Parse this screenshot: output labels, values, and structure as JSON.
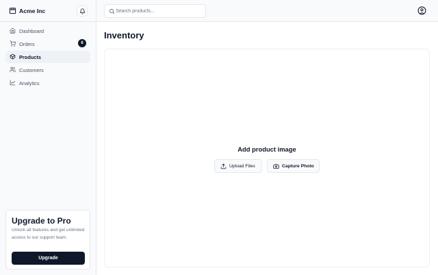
{
  "app": {
    "name": "Acme Inc"
  },
  "sidebar": {
    "items": [
      {
        "label": "Dashboard",
        "icon": "home-icon"
      },
      {
        "label": "Orders",
        "icon": "cart-icon",
        "badge": "6"
      },
      {
        "label": "Products",
        "icon": "package-icon",
        "active": true
      },
      {
        "label": "Customers",
        "icon": "users-icon"
      },
      {
        "label": "Analytics",
        "icon": "line-chart-icon"
      }
    ]
  },
  "upgrade": {
    "title": "Upgrade to Pro",
    "text": "Unlock all features and get unlimited access to our support team.",
    "button": "Upgrade"
  },
  "search": {
    "placeholder": "Search products...",
    "value": ""
  },
  "page": {
    "title": "Inventory"
  },
  "dropzone": {
    "title": "Add product image",
    "upload_label": "Upload Files",
    "capture_label": "Capture Photo"
  },
  "colors": {
    "primary": "#0f172a",
    "muted": "#64748b",
    "border": "#e5e7eb",
    "sidebar_bg": "#f8fafc"
  }
}
